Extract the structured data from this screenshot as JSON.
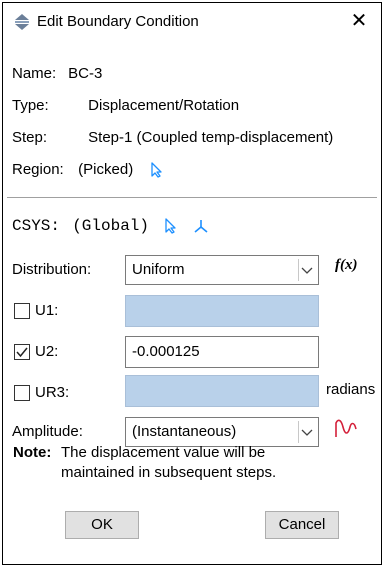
{
  "window": {
    "title": "Edit Boundary Condition",
    "close_glyph": "✕"
  },
  "info": {
    "name_label": "Name:",
    "name_value": "BC-3",
    "type_label": "Type:",
    "type_value": "Displacement/Rotation",
    "step_label": "Step:",
    "step_value": "Step-1 (Coupled temp-displacement)",
    "region_label": "Region:",
    "region_value": "(Picked)"
  },
  "csys": {
    "label": "CSYS:",
    "value": "(Global)"
  },
  "distribution": {
    "label": "Distribution:",
    "value": "Uniform",
    "fx_label": "f(x)"
  },
  "dofs": [
    {
      "label": "U1:",
      "checked": false,
      "value": ""
    },
    {
      "label": "U2:",
      "checked": true,
      "value": "-0.000125"
    },
    {
      "label": "UR3:",
      "checked": false,
      "value": "",
      "unit": "radians"
    }
  ],
  "amplitude": {
    "label": "Amplitude:",
    "value": "(Instantaneous)"
  },
  "note": {
    "prefix": "Note:",
    "line1": "The displacement value will be",
    "line2": "maintained in subsequent steps."
  },
  "buttons": {
    "ok": "OK",
    "cancel": "Cancel"
  },
  "colors": {
    "accent_blue": "#1e90ff",
    "disabled_field": "#b9d1ea",
    "amp_red": "#d4203a"
  }
}
